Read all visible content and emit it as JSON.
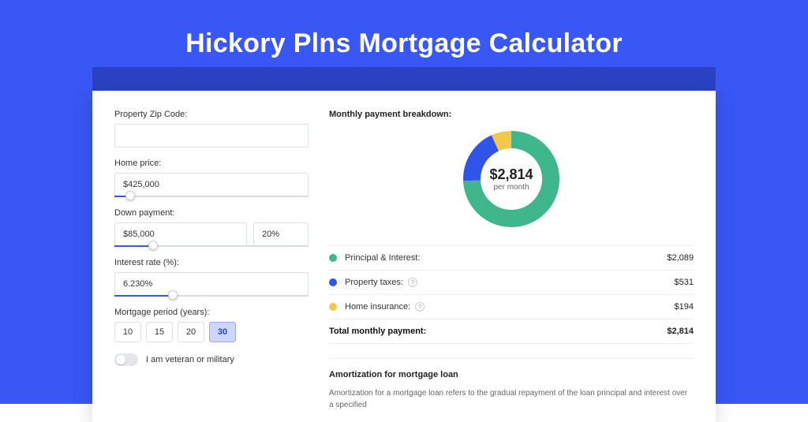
{
  "title": "Hickory Plns Mortgage Calculator",
  "form": {
    "zip": {
      "label": "Property Zip Code:",
      "value": ""
    },
    "homePrice": {
      "label": "Home price:",
      "value": "$425,000",
      "sliderPct": 8
    },
    "downPayment": {
      "label": "Down payment:",
      "amount": "$85,000",
      "percent": "20%",
      "sliderPct": 20
    },
    "interest": {
      "label": "Interest rate (%):",
      "value": "6.230%",
      "sliderPct": 30
    },
    "period": {
      "label": "Mortgage period (years):",
      "options": [
        "10",
        "15",
        "20",
        "30"
      ],
      "active": "30"
    },
    "veteran": {
      "label": "I am veteran or military",
      "on": false
    }
  },
  "breakdown": {
    "title": "Monthly payment breakdown:",
    "centerAmount": "$2,814",
    "centerSub": "per month",
    "items": [
      {
        "key": "pi",
        "color": "green",
        "label": "Principal & Interest:",
        "value": "$2,089",
        "info": false
      },
      {
        "key": "tax",
        "color": "blue",
        "label": "Property taxes:",
        "value": "$531",
        "info": true
      },
      {
        "key": "ins",
        "color": "yellow",
        "label": "Home insurance:",
        "value": "$194",
        "info": true
      }
    ],
    "totalLabel": "Total monthly payment:",
    "totalValue": "$2,814"
  },
  "amort": {
    "title": "Amortization for mortgage loan",
    "text": "Amortization for a mortgage loan refers to the gradual repayment of the loan principal and interest over a specified"
  },
  "chart_data": {
    "type": "pie",
    "title": "Monthly payment breakdown",
    "categories": [
      "Principal & Interest",
      "Property taxes",
      "Home insurance"
    ],
    "values": [
      2089,
      531,
      194
    ],
    "colors": [
      "#3fb68b",
      "#2e54e8",
      "#f2c84b"
    ],
    "total": 2814
  }
}
